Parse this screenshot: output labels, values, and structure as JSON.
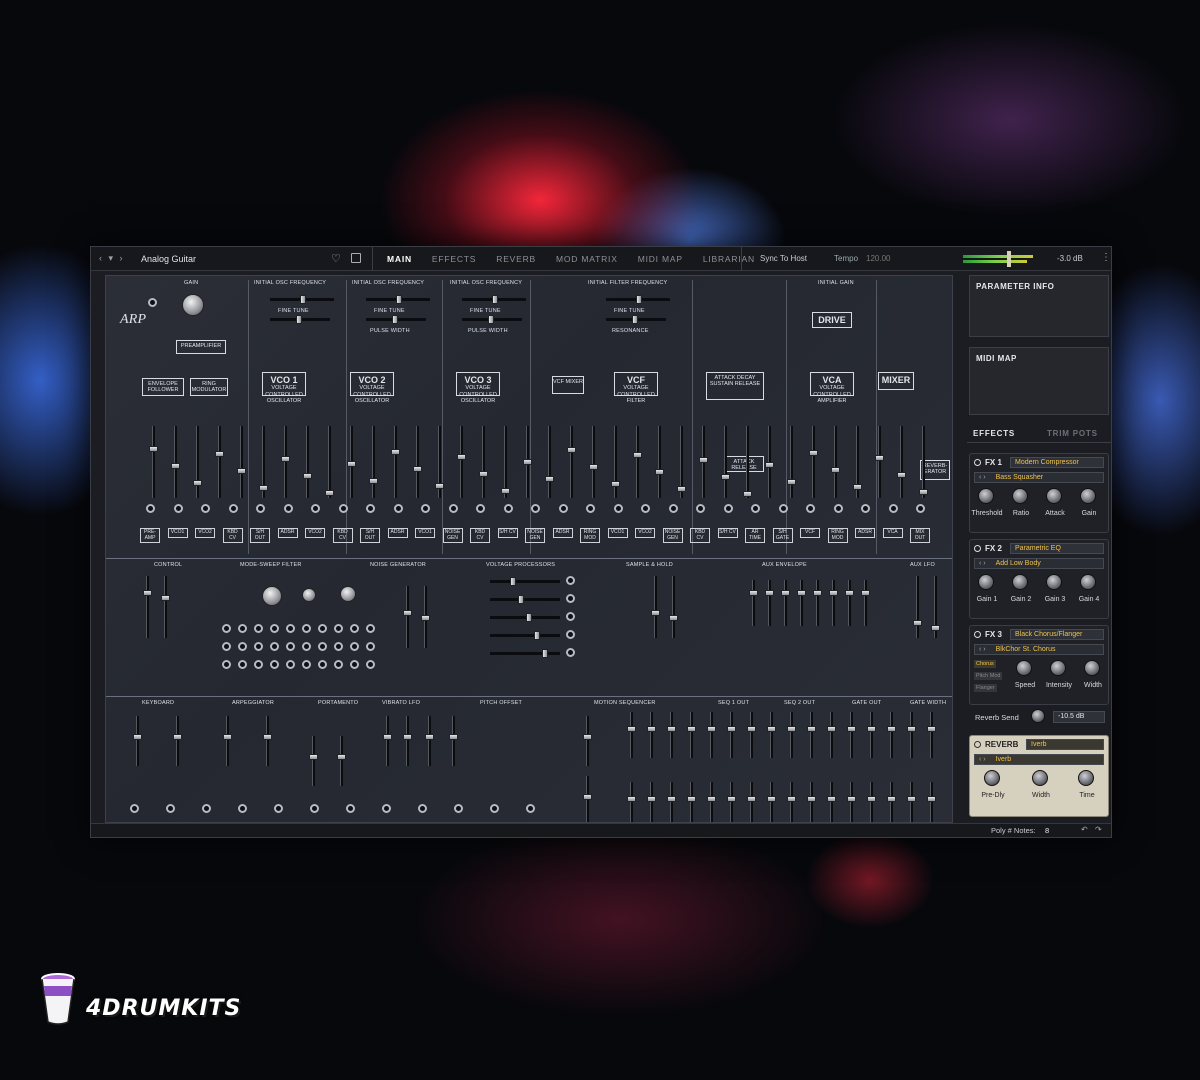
{
  "window": {
    "nav_glyph": "‹ ▾ ›",
    "preset_name": "Analog Guitar",
    "tabs": [
      "MAIN",
      "EFFECTS",
      "REVERB",
      "MOD MATRIX",
      "MIDI MAP",
      "LIBRARIAN"
    ],
    "active_tab": "MAIN",
    "sync_label": "Sync To Host",
    "tempo_label": "Tempo",
    "tempo_value": "120.00",
    "output_level": "-3.0 dB",
    "menu_glyph": "⋮"
  },
  "synth": {
    "sections": {
      "gain": "GAIN",
      "osc_freq_1": "INITIAL OSC FREQUENCY",
      "osc_freq_2": "INITIAL OSC FREQUENCY",
      "osc_freq_3": "INITIAL OSC FREQUENCY",
      "filter_freq": "INITIAL FILTER FREQUENCY",
      "initial_gain": "INITIAL GAIN",
      "fine_tune": "FINE TUNE",
      "pulse_width": "PULSE WIDTH",
      "resonance": "RESONANCE",
      "control": "CONTROL",
      "mode_sweep": "MODE-SWEEP FILTER",
      "noise_gen": "NOISE GENERATOR",
      "voltage_proc": "VOLTAGE PROCESSORS",
      "sample_hold": "SAMPLE & HOLD",
      "aux_env": "AUX ENVELOPE",
      "aux_lfo": "AUX LFO",
      "keyboard": "KEYBOARD",
      "arpeggiator": "ARPEGGIATOR",
      "portamento": "PORTAMENTO",
      "vibrato_lfo": "VIBRATO LFO",
      "pitch_offset": "PITCH OFFSET",
      "motion_seq": "MOTION SEQUENCER",
      "seq1_out": "SEQ 1 OUT",
      "seq2_out": "SEQ 2 OUT",
      "gate_out": "GATE OUT",
      "gate_width": "GATE WIDTH"
    },
    "modules": {
      "preamp": "PREAMPLIFIER",
      "env_follower": "ENVELOPE FOLLOWER",
      "ring_mod": "RING MODULATOR",
      "vco1": "VCO 1",
      "vco2": "VCO 2",
      "vco3": "VCO 3",
      "vcf_mixer": "VCF MIXER",
      "vcf": "VCF",
      "adsr": "ATTACK DECAY SUSTAIN RELEASE",
      "ar": "ATTACK RELEASE",
      "drive": "DRIVE",
      "vca": "VCA",
      "mixer": "MIXER",
      "reverberator": "REVERB- ERATOR",
      "vco_sub": "VOLTAGE CONTROLLED OSCILLATOR",
      "vcf_sub": "VOLTAGE CONTROLLED FILTER",
      "vca_sub": "VOLTAGE CONTROLLED AMPLIFIER"
    },
    "bottom_jacks": [
      "PRE-AMP",
      "VCO1",
      "VCO2",
      "KBD CV",
      "S/H OUT",
      "ADSR",
      "VCO2",
      "KBD CV",
      "S/H OUT",
      "ADSR",
      "VCO1",
      "NOISE GEN",
      "KBD CV",
      "S/H CV",
      "NOISE GEN",
      "ADSR",
      "RING MOD",
      "VCO1",
      "VCO2",
      "NOISE GEN",
      "KBD CV",
      "S/H CV",
      "AR TIME",
      "S/H GATE",
      "VCF",
      "RING MOD",
      "ADSR",
      "VCA",
      "MIX OUT"
    ],
    "logo": "ARP"
  },
  "right_panel": {
    "parameter_info": "PARAMETER INFO",
    "midi_map": "MIDI MAP",
    "effects_tab": "EFFECTS",
    "trim_tab": "TRIM POTS",
    "fx": [
      {
        "label": "FX 1",
        "type": "Modern Compressor",
        "preset": "Bass Squasher",
        "knobs": [
          "Threshold",
          "Ratio",
          "Attack",
          "Gain"
        ]
      },
      {
        "label": "FX 2",
        "type": "Parametric EQ",
        "preset": "Add Low Body",
        "knobs": [
          "Gain 1",
          "Gain 2",
          "Gain 3",
          "Gain 4"
        ]
      },
      {
        "label": "FX 3",
        "type": "Black Chorus/Flanger",
        "preset": "BlkChor St. Chorus",
        "modes": [
          "Chorus",
          "Pitch Mod",
          "Flanger"
        ],
        "knobs": [
          "Speed",
          "Intensity",
          "Width"
        ]
      }
    ],
    "reverb_send_label": "Reverb Send",
    "reverb_send_value": "-10.5 dB",
    "reverb": {
      "label": "REVERB",
      "type": "Iverb",
      "preset": "Iverb",
      "knobs": [
        "Pre-Dly",
        "Width",
        "Time"
      ]
    }
  },
  "bottom_bar": {
    "poly_label": "Poly # Notes:",
    "poly_value": "8"
  },
  "brand": {
    "logo_text": "4DRUMKITS"
  },
  "colors": {
    "accent": "#f0c24a",
    "background": "#07080c",
    "panel": "#2b2e37"
  }
}
